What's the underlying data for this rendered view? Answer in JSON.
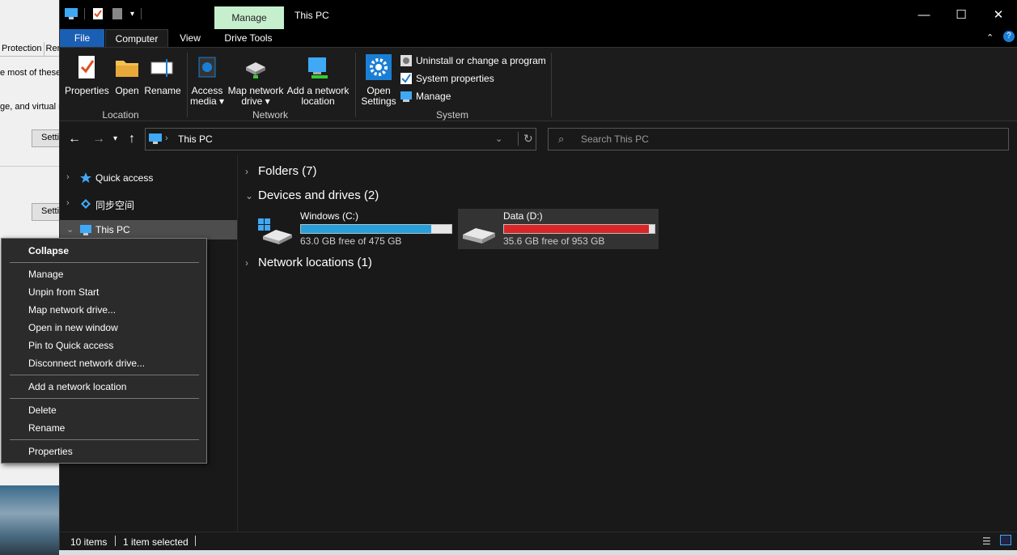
{
  "background_window": {
    "tabs": [
      "Protection",
      "Rem"
    ],
    "line1": "e most of these",
    "line2": "ge, and virtual m",
    "button1": "Setti",
    "button2": "Setti"
  },
  "window": {
    "title": "This PC",
    "contextual_tab": "Manage",
    "minimize": "—",
    "maximize": "☐",
    "close": "✕"
  },
  "ribbon_tabs": {
    "file": "File",
    "computer": "Computer",
    "view": "View",
    "drive_tools": "Drive Tools"
  },
  "ribbon": {
    "location": {
      "label": "Location",
      "properties": "Properties",
      "open": "Open",
      "rename": "Rename"
    },
    "network": {
      "label": "Network",
      "access_media_1": "Access",
      "access_media_2": "media ▾",
      "map_drive_1": "Map network",
      "map_drive_2": "drive ▾",
      "add_location_1": "Add a network",
      "add_location_2": "location"
    },
    "system": {
      "label": "System",
      "open_settings_1": "Open",
      "open_settings_2": "Settings",
      "uninstall": "Uninstall or change a program",
      "system_properties": "System properties",
      "manage": "Manage"
    }
  },
  "address": {
    "path": "This PC",
    "search_placeholder": "Search This PC"
  },
  "nav_pane": {
    "quick_access": "Quick access",
    "sync": "同步空间",
    "this_pc": "This PC"
  },
  "content": {
    "folders": "Folders (7)",
    "devices": "Devices and drives (2)",
    "network": "Network locations (1)",
    "drives": [
      {
        "name": "Windows (C:)",
        "free": "63.0 GB free of 475 GB",
        "used_fraction": 0.867,
        "color": "#26a0da"
      },
      {
        "name": "Data (D:)",
        "free": "35.6 GB free of 953 GB",
        "used_fraction": 0.963,
        "color": "#da2626"
      }
    ]
  },
  "status": {
    "items": "10 items",
    "selected": "1 item selected"
  },
  "context_menu": {
    "collapse": "Collapse",
    "manage": "Manage",
    "unpin": "Unpin from Start",
    "map_drive": "Map network drive...",
    "open_new": "Open in new window",
    "pin_quick": "Pin to Quick access",
    "disconnect": "Disconnect network drive...",
    "add_location": "Add a network location",
    "delete": "Delete",
    "rename": "Rename",
    "properties": "Properties"
  }
}
